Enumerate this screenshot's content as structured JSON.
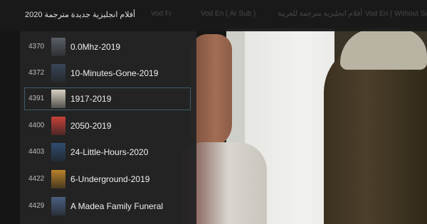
{
  "header": {
    "category_title": "أفلام انجليزية جديدة مترجمة 2020",
    "tabs": [
      {
        "label": "Vod Fr"
      },
      {
        "label": "Vod En ( Ar Sub )"
      },
      {
        "label": "أفلام انجليزية مترجمة للعربية"
      },
      {
        "label": "Vod En ( Without Sub"
      }
    ]
  },
  "movies": [
    {
      "number": "4370",
      "title": "0.0Mhz-2019",
      "poster_color": "#5a5f68",
      "selected": false
    },
    {
      "number": "4372",
      "title": "10-Minutes-Gone-2019",
      "poster_color": "#3a4658",
      "selected": false
    },
    {
      "number": "4391",
      "title": "1917-2019",
      "poster_color": "#d8d2c4",
      "selected": true
    },
    {
      "number": "4400",
      "title": "2050-2019",
      "poster_color": "#c7423a",
      "selected": false
    },
    {
      "number": "4403",
      "title": "24-Little-Hours-2020",
      "poster_color": "#2f4c6e",
      "selected": false
    },
    {
      "number": "4422",
      "title": "6-Underground-2019",
      "poster_color": "#b8812a",
      "selected": false
    },
    {
      "number": "4429",
      "title": "A Madea Family Funeral",
      "poster_color": "#4a5f80",
      "selected": false
    }
  ]
}
